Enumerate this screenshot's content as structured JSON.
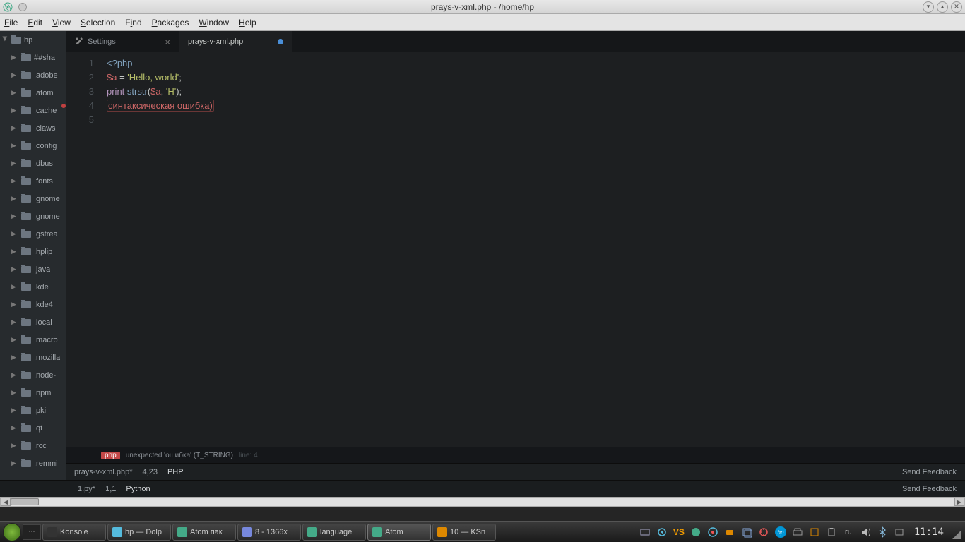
{
  "window": {
    "title": "prays-v-xml.php - /home/hp"
  },
  "menu": {
    "file": "File",
    "edit": "Edit",
    "view": "View",
    "selection": "Selection",
    "find": "Find",
    "packages": "Packages",
    "window": "Window",
    "help": "Help"
  },
  "tree": {
    "root": "hp",
    "folders": [
      "##sha",
      ".adobe",
      ".atom",
      ".cache",
      ".claws",
      ".config",
      ".dbus",
      ".fonts",
      ".gnome",
      ".gnome",
      ".gstrea",
      ".hplip",
      ".java",
      ".kde",
      ".kde4",
      ".local",
      ".macro",
      ".mozilla",
      ".node-",
      ".npm",
      ".pki",
      ".qt",
      ".rcc",
      ".remmi"
    ]
  },
  "tabs": {
    "settings": "Settings",
    "file": "prays-v-xml.php"
  },
  "code": {
    "l1_open": "<?php",
    "l2_var": "$a",
    "l2_eq": " = ",
    "l2_str": "'Hello, world'",
    "l2_end": ";",
    "l3_kw": "print",
    "l3_sp": " ",
    "l3_fn": "strstr",
    "l3_p1": "(",
    "l3_var": "$a",
    "l3_c": ", ",
    "l3_str": "'H'",
    "l3_p2": ");",
    "l4_err": "синтаксическая ошибка)",
    "nums": {
      "n1": "1",
      "n2": "2",
      "n3": "3",
      "n4": "4",
      "n5": "5"
    }
  },
  "linter": {
    "badge": "php",
    "msg": "unexpected 'ошибка' (T_STRING)",
    "line_label": "line:",
    "line_num": "4"
  },
  "status1": {
    "file": "prays-v-xml.php*",
    "pos": "4,23",
    "lang": "PHP",
    "feedback": "Send Feedback"
  },
  "status2": {
    "file": "1.py*",
    "pos": "1,1",
    "lang": "Python",
    "feedback": "Send Feedback"
  },
  "taskbar": {
    "tasks": [
      {
        "label": "Konsole"
      },
      {
        "label": "hp — Dolp"
      },
      {
        "label": "Atom пак"
      },
      {
        "label": "8 - 1366x"
      },
      {
        "label": "language"
      },
      {
        "label": "Atom"
      },
      {
        "label": "10 — KSn"
      }
    ],
    "lang": "ru",
    "clock": "11:14"
  }
}
